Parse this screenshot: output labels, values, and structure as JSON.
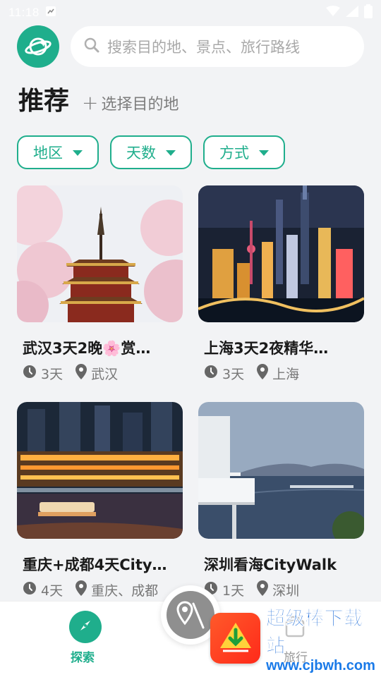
{
  "status_bar": {
    "time": "11:18"
  },
  "search": {
    "placeholder": "搜索目的地、景点、旅行路线"
  },
  "section": {
    "title": "推荐",
    "pick_destination": "选择目的地"
  },
  "filters": [
    {
      "label": "地区"
    },
    {
      "label": "天数"
    },
    {
      "label": "方式"
    }
  ],
  "cards": [
    {
      "title": "武汉3天2晚🌸赏…",
      "days": "3天",
      "location": "武汉"
    },
    {
      "title": "上海3天2夜精华…",
      "days": "3天",
      "location": "上海"
    },
    {
      "title": "重庆+成都4天City…",
      "days": "4天",
      "location": "重庆、成都"
    },
    {
      "title": "深圳看海CityWalk",
      "days": "1天",
      "location": "深圳"
    }
  ],
  "bottom_nav": {
    "explore_label": "探索",
    "trip_label": "旅行"
  },
  "watermark": {
    "name": "超级棒下载站",
    "url": "www.cjbwh.com"
  },
  "colors": {
    "accent": "#1fae8c",
    "background": "#f2f3f5"
  }
}
